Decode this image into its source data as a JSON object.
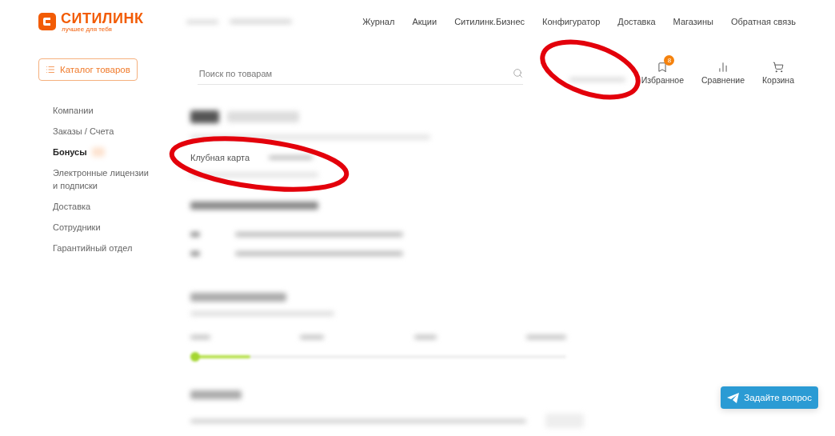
{
  "logo": {
    "name": "СИТИЛИНК",
    "tagline": "лучшее для тебя"
  },
  "top_nav": [
    "Журнал",
    "Акции",
    "Ситилинк.Бизнес",
    "Конфигуратор",
    "Доставка",
    "Магазины",
    "Обратная связь"
  ],
  "catalog_button": "Каталог товаров",
  "search": {
    "placeholder": "Поиск по товарам"
  },
  "header_actions": [
    {
      "label": "Избранное",
      "kind": "favorites",
      "badge": "8"
    },
    {
      "label": "Сравнение",
      "kind": "compare"
    },
    {
      "label": "Корзина",
      "kind": "cart"
    }
  ],
  "sidebar": {
    "items": [
      {
        "label": "Компании",
        "selected": false
      },
      {
        "label": "Заказы / Счета",
        "selected": false
      },
      {
        "label": "Бонусы",
        "selected": true
      },
      {
        "label": "Электронные лицензии и подписки",
        "selected": false
      },
      {
        "label": "Доставка",
        "selected": false
      },
      {
        "label": "Сотрудники",
        "selected": false
      },
      {
        "label": "Гарантийный отдел",
        "selected": false
      }
    ]
  },
  "club_card": {
    "label": "Клубная карта"
  },
  "bonus_progress": {
    "level": 0.16
  },
  "chat_button": "Задайте вопрос"
}
